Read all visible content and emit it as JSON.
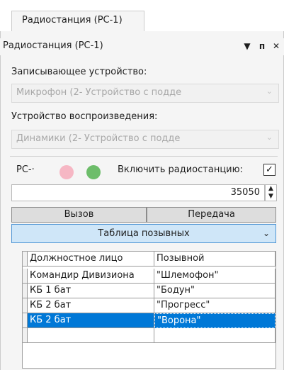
{
  "tab": {
    "label": "Радиостанция (РС-1)"
  },
  "panel": {
    "title": "Радиостанция (РС-1)",
    "pin_icon": "pin-icon",
    "dropdown_icon": "chevron-down-icon",
    "close_icon": "close-icon",
    "pin_glyph": "ᴨ",
    "close_glyph": "✕",
    "down_glyph": "▼"
  },
  "recording": {
    "label": "Записывающее устройство:",
    "value": "Микрофон (2- Устройство с подде"
  },
  "playback": {
    "label": "Устройство воспроизведения:",
    "value": "Динамики (2- Устройство с подде"
  },
  "station": {
    "label": "РС-·",
    "led_red": "#f6b7c4",
    "led_green": "#6dbd6a",
    "enable_label": "Включить радиостанцию:",
    "enabled": "✓",
    "frequency": "35050"
  },
  "buttons": {
    "call": "Вызов",
    "transmit": "Передача"
  },
  "callsign_dropdown": {
    "label": "Таблица позывных"
  },
  "table": {
    "headers": [
      "Должностное лицо",
      "Позывной"
    ],
    "rows": [
      [
        "Командир Дивизиона",
        "\"Шлемофон\""
      ],
      [
        "КБ 1 бат",
        "\"Бодун\""
      ],
      [
        "КБ 2 бат",
        "\"Прогресс\""
      ],
      [
        "КБ 2 бат",
        "\"Ворона\""
      ],
      [
        "",
        ""
      ]
    ]
  }
}
